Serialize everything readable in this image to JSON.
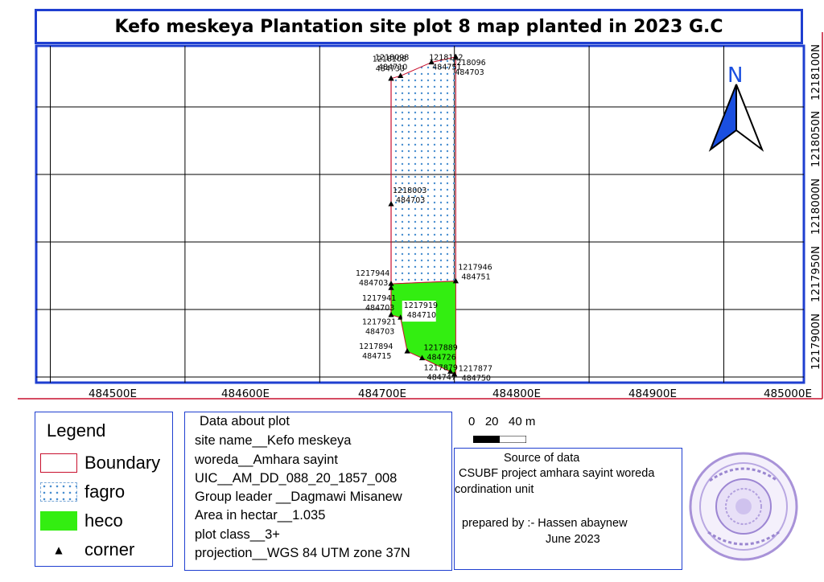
{
  "title": "Kefo meskeya Plantation site plot 8 map planted in 2023 G.C",
  "north_arrow": {
    "label": "N",
    "color": "#1a4fe0"
  },
  "colors": {
    "frame": "#1f3fd0",
    "boundary": "#c8102e",
    "fagro_dots": "#4a8fd0",
    "heco": "#33ee11"
  },
  "map": {
    "x_ticks": [
      "484500E",
      "484600E",
      "484700E",
      "484800E",
      "484900E",
      "485000E"
    ],
    "y_ticks": [
      "1217900N",
      "1217950N",
      "1218000N",
      "1218050N",
      "1218100N"
    ],
    "corner_labels": [
      {
        "north": "1218098",
        "east": "484710"
      },
      {
        "north": "1218108",
        "east": "484733"
      },
      {
        "north": "1218112",
        "east": "484751"
      },
      {
        "north": "1218096",
        "east": "484703"
      },
      {
        "north": "1218003",
        "east": "484703"
      },
      {
        "north": "1217944",
        "east": "484703"
      },
      {
        "north": "1217946",
        "east": "484751"
      },
      {
        "north": "1217941",
        "east": "484703"
      },
      {
        "north": "1217919",
        "east": "484710"
      },
      {
        "north": "1217921",
        "east": "484703"
      },
      {
        "north": "1217889",
        "east": "484726"
      },
      {
        "north": "1217894",
        "east": "484715"
      },
      {
        "north": "1217877",
        "east": "484750"
      },
      {
        "north": "1217879",
        "east": "484747"
      }
    ]
  },
  "legend": {
    "title": "Legend",
    "items": [
      {
        "label": "Boundary",
        "icon": "boundary-line"
      },
      {
        "label": "fagro",
        "icon": "dotted-fill"
      },
      {
        "label": "heco",
        "icon": "green-fill"
      },
      {
        "label": "corner",
        "icon": "triangle-icon"
      }
    ]
  },
  "plot_info": {
    "heading": "Data about plot",
    "site_name": "site name__Kefo meskeya",
    "woreda": "woreda__Amhara sayint",
    "uic": "UIC__AM_DD_088_20_1857_008",
    "group_leader": "Group leader __Dagmawi Misanew",
    "area": "Area in hectar__1.035",
    "plot_class": "plot class__3+",
    "projection": "projection__WGS 84 UTM zone 37N"
  },
  "scale": {
    "text": "0   20   40 m"
  },
  "source": {
    "heading": "Source of data",
    "line1": "CSUBF project amhara sayint woreda",
    "line2": "cordination unit",
    "prepared_by": "prepared by :- Hassen abaynew",
    "date": "June 2023"
  }
}
